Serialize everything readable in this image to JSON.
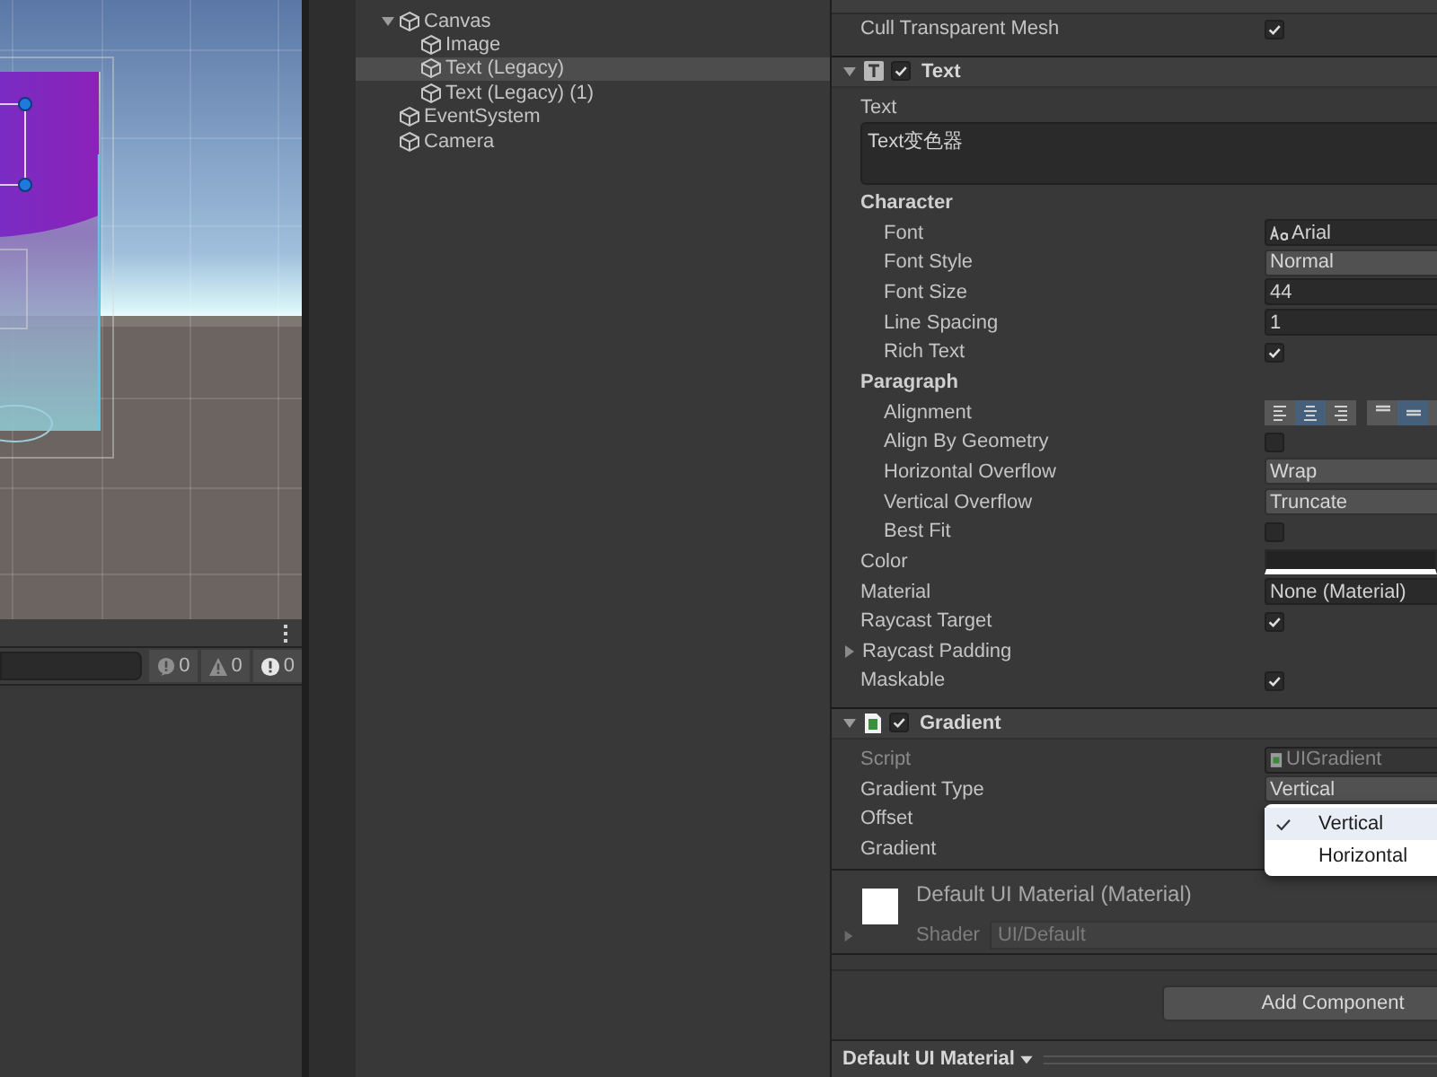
{
  "hierarchy": {
    "items": [
      {
        "label": "Canvas",
        "expanded": true,
        "selected": false,
        "children": [
          {
            "label": "Image",
            "selected": false
          },
          {
            "label": "Text (Legacy)",
            "selected": true
          },
          {
            "label": "Text (Legacy) (1)",
            "selected": false
          }
        ]
      },
      {
        "label": "EventSystem",
        "selected": false
      },
      {
        "label": "Camera",
        "selected": false
      }
    ]
  },
  "console": {
    "counts": [
      {
        "kind": "info",
        "value": "0"
      },
      {
        "kind": "warning",
        "value": "0"
      },
      {
        "kind": "error",
        "value": "0"
      }
    ]
  },
  "inspector": {
    "top_properties": [
      {
        "kind": "checkbox",
        "label": "Cull Transparent Mesh",
        "checked": true
      }
    ],
    "components": [
      {
        "title": "Text",
        "kind": "text",
        "enabled": true,
        "expanded": true,
        "properties": [
          {
            "kind": "textarea",
            "label": "Text",
            "value": "Text变色器"
          },
          {
            "kind": "group",
            "label": "Character",
            "children": [
              {
                "kind": "font",
                "label": "Font",
                "value": "Arial"
              },
              {
                "kind": "dropdown",
                "label": "Font Style",
                "value": "Normal"
              },
              {
                "kind": "field",
                "label": "Font Size",
                "value": "44"
              },
              {
                "kind": "field",
                "label": "Line Spacing",
                "value": "1"
              },
              {
                "kind": "checkbox",
                "label": "Rich Text",
                "checked": true
              }
            ]
          },
          {
            "kind": "group",
            "label": "Paragraph",
            "children": [
              {
                "kind": "alignment",
                "label": "Alignment",
                "horizontal": [
                  {
                    "selected": false
                  },
                  {
                    "selected": true
                  },
                  {
                    "selected": false
                  }
                ],
                "vertical": [
                  {
                    "selected": false
                  },
                  {
                    "selected": true
                  },
                  {
                    "selected": false
                  }
                ]
              },
              {
                "kind": "checkbox",
                "label": "Align By Geometry",
                "checked": false
              },
              {
                "kind": "dropdown",
                "label": "Horizontal Overflow",
                "value": "Wrap"
              },
              {
                "kind": "dropdown",
                "label": "Vertical Overflow",
                "value": "Truncate"
              },
              {
                "kind": "checkbox",
                "label": "Best Fit",
                "checked": false
              }
            ]
          },
          {
            "kind": "color",
            "label": "Color"
          },
          {
            "kind": "object",
            "label": "Material",
            "value": "None (Material)"
          },
          {
            "kind": "checkbox",
            "label": "Raycast Target",
            "checked": true
          },
          {
            "kind": "foldout",
            "label": "Raycast Padding",
            "expanded": false
          },
          {
            "kind": "checkbox",
            "label": "Maskable",
            "checked": true
          }
        ]
      },
      {
        "title": "Gradient",
        "kind": "script",
        "enabled": true,
        "expanded": true,
        "properties": [
          {
            "kind": "script",
            "label": "Script",
            "value": "UIGradient"
          },
          {
            "kind": "dropdown",
            "label": "Gradient Type",
            "value": "Vertical"
          },
          {
            "kind": "label",
            "label": "Offset"
          },
          {
            "kind": "label",
            "label": "Gradient"
          }
        ]
      }
    ],
    "material_preview": {
      "title": "Default UI Material (Material)",
      "shader_label": "Shader",
      "shader": "UI/Default"
    },
    "add_component": "Add Component",
    "footer": {
      "label": "Default UI Material"
    }
  },
  "dropdown_popup": {
    "items": [
      {
        "label": "Vertical",
        "selected": true
      },
      {
        "label": "Horizontal",
        "selected": false
      }
    ]
  }
}
